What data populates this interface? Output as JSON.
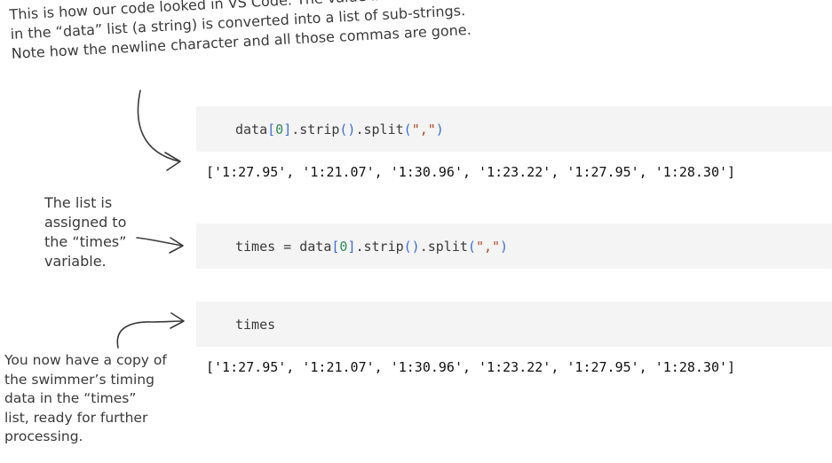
{
  "annotations": {
    "top": "This is how our code looked in VS Code. The value in the first slot\nin the “data” list (a string) is converted into a list of sub-strings.\nNote how the newline character and all those commas are gone.",
    "middle": "The list is\nassigned to\nthe “times”\nvariable.",
    "bottom": "You now have a copy of\nthe swimmer’s timing\ndata in the “times”\nlist, ready for further\nprocessing."
  },
  "cells": [
    {
      "code_parts": [
        "data",
        "[",
        "0",
        "]",
        ".strip",
        "()",
        ".split",
        "(",
        "\",\"",
        ")"
      ],
      "output": "['1:27.95', '1:21.07', '1:30.96', '1:23.22', '1:27.95', '1:28.30']"
    },
    {
      "code_parts": [
        "times = data",
        "[",
        "0",
        "]",
        ".strip",
        "()",
        ".split",
        "(",
        "\",\"",
        ")"
      ]
    },
    {
      "code_parts": [
        "times"
      ],
      "output": "['1:27.95', '1:21.07', '1:30.96', '1:23.22', '1:27.95', '1:28.30']"
    }
  ],
  "colors": {
    "cell_background": "#f4f4f4",
    "bracket": "#3b6fd6",
    "number": "#2e8b57",
    "string": "#b14a28",
    "annotation_text": "#3a3a3a"
  }
}
